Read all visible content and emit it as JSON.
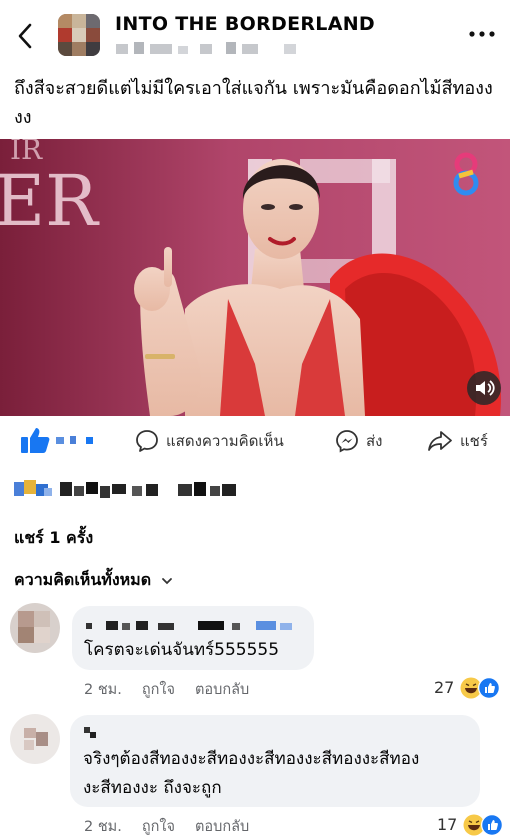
{
  "header": {
    "page_name": "INTO THE BORDERLAND",
    "back_icon": "chevron-left-icon",
    "more_icon": "more-horizontal-icon"
  },
  "post": {
    "caption": "ถึงสีจะสวยดีแต่ไม่มีใครเอาใส่แจกัน เพราะมันคือดอกไม้สีทองงงง"
  },
  "actions": {
    "comment_label": "แสดงความคิดเห็น",
    "send_label": "ส่ง",
    "share_label": "แชร์"
  },
  "stats": {
    "shares": "แชร์ 1 ครั้ง"
  },
  "comments_filter": {
    "label": "ความคิดเห็นทั้งหมด"
  },
  "comments": [
    {
      "text": "โครตจะเด่นจันทร์555555",
      "time": "2 ชม.",
      "like": "ถูกใจ",
      "reply": "ตอบกลับ",
      "reaction_count": "27"
    },
    {
      "text_line1": "จริงๆต้องสีทองงะสีทองงะสีทองงะสีทองงะสีทอง",
      "text_line2": "งะสีทองงะ ถึงจะถูก",
      "time": "2 ชม.",
      "like": "ถูกใจ",
      "reply": "ตอบกลับ",
      "reaction_count": "17"
    }
  ],
  "colors": {
    "fb_blue": "#1877f2",
    "bubble_bg": "#f0f2f5",
    "meta_gray": "#65676b"
  }
}
